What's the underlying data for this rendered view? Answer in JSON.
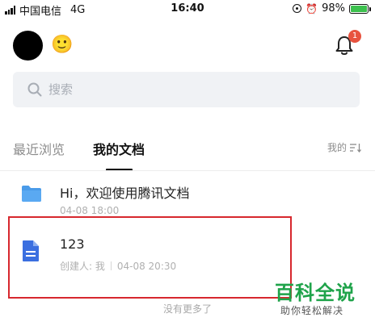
{
  "status_bar": {
    "carrier": "中国电信",
    "network": "4G",
    "time": "16:40",
    "battery": "98%",
    "battery_level": 0.98
  },
  "header": {
    "notification_count": "1"
  },
  "search": {
    "placeholder": "搜索"
  },
  "tabs": [
    {
      "label": "最近浏览",
      "active": false
    },
    {
      "label": "我的文档",
      "active": true
    }
  ],
  "sort": {
    "label": "我的"
  },
  "documents": [
    {
      "title": "Hi，欢迎使用腾讯文档",
      "meta": "04-08 18:00",
      "icon": "folder-icon"
    },
    {
      "title": "123",
      "creator": "创建人: 我",
      "meta": "04-08 20:30",
      "icon": "doc-icon"
    }
  ],
  "footer": {
    "text": "没有更多了"
  },
  "watermark": {
    "title": "百科全说",
    "subtitle": "助你轻松解决"
  },
  "colors": {
    "badge": "#e8533f",
    "folder": "#4a9be9",
    "doc": "#3b6fe0",
    "highlight": "#d7282e",
    "watermark": "#1fa34a"
  }
}
